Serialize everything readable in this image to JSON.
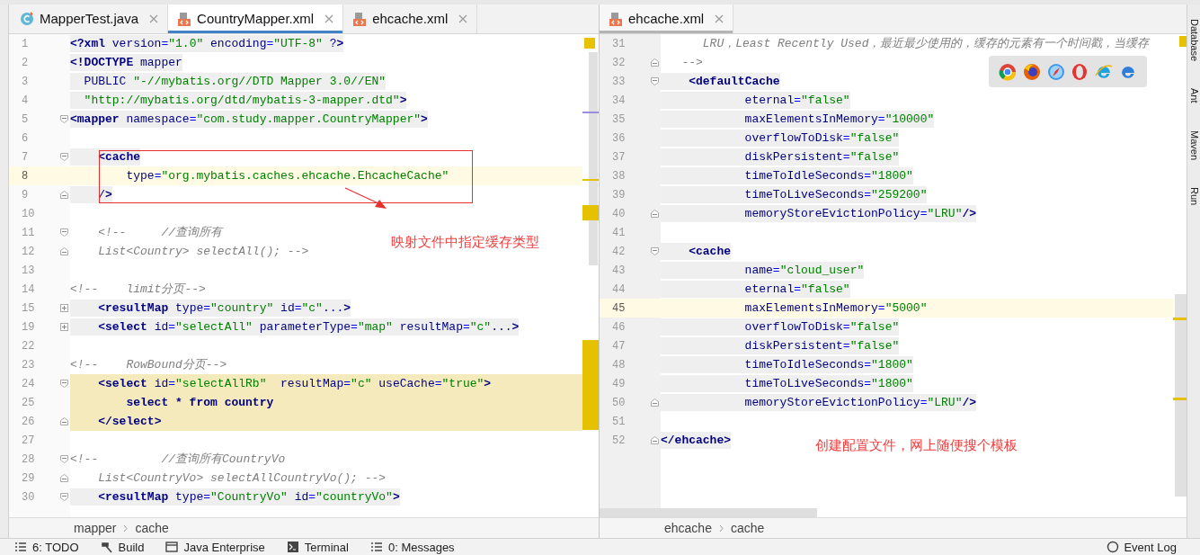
{
  "panes": [
    {
      "focused": true,
      "tabs": [
        {
          "label": "MapperTest.java",
          "kind": "class",
          "selected": false
        },
        {
          "label": "CountryMapper.xml",
          "kind": "xml",
          "selected": true
        },
        {
          "label": "ehcache.xml",
          "kind": "xml",
          "selected": false
        }
      ],
      "lines": [
        {
          "num": "1",
          "kind": "markup",
          "text": "<?xml version=\"1.0\" encoding=\"UTF-8\" ?>"
        },
        {
          "num": "2",
          "kind": "markup",
          "text": "<!DOCTYPE mapper"
        },
        {
          "num": "3",
          "kind": "markup",
          "text": "  PUBLIC \"-//mybatis.org//DTD Mapper 3.0//EN\""
        },
        {
          "num": "4",
          "kind": "markup",
          "text": "  \"http://mybatis.org/dtd/mybatis-3-mapper.dtd\">"
        },
        {
          "num": "5",
          "kind": "markup",
          "expanded": true,
          "text": "<mapper namespace=\"com.study.mapper.CountryMapper\">"
        },
        {
          "num": "6",
          "kind": "blank"
        },
        {
          "num": "7",
          "kind": "markup",
          "expanded": true,
          "text": "    <cache"
        },
        {
          "num": "8",
          "kind": "markup",
          "current": true,
          "text": "        type=\"org.mybatis.caches.ehcache.EhcacheCache\""
        },
        {
          "num": "9",
          "kind": "markup",
          "fold_end": true,
          "text": "    />"
        },
        {
          "num": "10",
          "kind": "blank"
        },
        {
          "num": "11",
          "kind": "comment",
          "expanded": true,
          "text": "    <!--     //查询所有"
        },
        {
          "num": "12",
          "kind": "comment",
          "fold_end": true,
          "text": "    List<Country> selectAll(); -->"
        },
        {
          "num": "13",
          "kind": "blank"
        },
        {
          "num": "14",
          "kind": "comment",
          "text": "<!--    limit分页-->"
        },
        {
          "num": "15",
          "kind": "markup",
          "expanded": false,
          "text": "    <resultMap type=\"country\" id=\"c\"...>"
        },
        {
          "num": "19",
          "kind": "markup",
          "expanded": false,
          "text": "    <select id=\"selectAll\" parameterType=\"map\" resultMap=\"c\"...>"
        },
        {
          "num": "22",
          "kind": "blank"
        },
        {
          "num": "23",
          "kind": "comment",
          "text": "<!--    RowBound分页-->"
        },
        {
          "num": "24",
          "kind": "markup",
          "expanded": true,
          "changed": true,
          "text": "    <select id=\"selectAllRb\"  resultMap=\"c\" useCache=\"true\">"
        },
        {
          "num": "25",
          "kind": "sql",
          "changed": true,
          "text": "        select * from country"
        },
        {
          "num": "26",
          "kind": "markup",
          "fold_end": true,
          "changed": true,
          "text": "    </select>"
        },
        {
          "num": "27",
          "kind": "blank"
        },
        {
          "num": "28",
          "kind": "comment",
          "expanded": true,
          "text": "<!--         //查询所有CountryVo"
        },
        {
          "num": "29",
          "kind": "comment",
          "fold_end": true,
          "text": "    List<CountryVo> selectAllCountryVo(); -->"
        },
        {
          "num": "30",
          "kind": "markup",
          "expanded": true,
          "text": "    <resultMap type=\"CountryVo\" id=\"countryVo\">"
        }
      ],
      "annotation": "映射文件中指定缓存类型",
      "breadcrumbs": [
        "mapper",
        "cache"
      ]
    },
    {
      "focused": false,
      "tabs": [
        {
          "label": "ehcache.xml",
          "kind": "xml",
          "selected": true
        }
      ],
      "lines": [
        {
          "num": "31",
          "kind": "comment",
          "text": "      LRU，Least Recently Used，最近最少使用的，缓存的元素有一个时间戳，当缓存"
        },
        {
          "num": "32",
          "kind": "comment",
          "fold_end": true,
          "text": "   -->"
        },
        {
          "num": "33",
          "kind": "markup",
          "expanded": true,
          "text": "    <defaultCache"
        },
        {
          "num": "34",
          "kind": "markup",
          "text": "            eternal=\"false\""
        },
        {
          "num": "35",
          "kind": "markup",
          "text": "            maxElementsInMemory=\"10000\""
        },
        {
          "num": "36",
          "kind": "markup",
          "text": "            overflowToDisk=\"false\""
        },
        {
          "num": "37",
          "kind": "markup",
          "text": "            diskPersistent=\"false\""
        },
        {
          "num": "38",
          "kind": "markup",
          "text": "            timeToIdleSeconds=\"1800\""
        },
        {
          "num": "39",
          "kind": "markup",
          "text": "            timeToLiveSeconds=\"259200\""
        },
        {
          "num": "40",
          "kind": "markup",
          "fold_end": true,
          "text": "            memoryStoreEvictionPolicy=\"LRU\"/>"
        },
        {
          "num": "41",
          "kind": "blank"
        },
        {
          "num": "42",
          "kind": "markup",
          "expanded": true,
          "text": "    <cache"
        },
        {
          "num": "43",
          "kind": "markup",
          "text": "            name=\"cloud_user\""
        },
        {
          "num": "44",
          "kind": "markup",
          "text": "            eternal=\"false\""
        },
        {
          "num": "45",
          "kind": "markup",
          "current": true,
          "text": "            maxElementsInMemory=\"5000\""
        },
        {
          "num": "46",
          "kind": "markup",
          "text": "            overflowToDisk=\"false\""
        },
        {
          "num": "47",
          "kind": "markup",
          "text": "            diskPersistent=\"false\""
        },
        {
          "num": "48",
          "kind": "markup",
          "text": "            timeToIdleSeconds=\"1800\""
        },
        {
          "num": "49",
          "kind": "markup",
          "text": "            timeToLiveSeconds=\"1800\""
        },
        {
          "num": "50",
          "kind": "markup",
          "fold_end": true,
          "text": "            memoryStoreEvictionPolicy=\"LRU\"/>"
        },
        {
          "num": "51",
          "kind": "blank"
        },
        {
          "num": "52",
          "kind": "markup",
          "fold_end": true,
          "text": "</ehcache>"
        }
      ],
      "annotation": "创建配置文件，网上随便搜个模板",
      "breadcrumbs": [
        "ehcache",
        "cache"
      ]
    }
  ],
  "right_tool_windows": [
    "Database",
    "Ant",
    "Maven",
    "Run"
  ],
  "bottom_tools": [
    {
      "label": "6: TODO",
      "kind": "list"
    },
    {
      "label": "Build",
      "kind": "hammer"
    },
    {
      "label": "Java Enterprise",
      "kind": "window"
    },
    {
      "label": "Terminal",
      "kind": "terminal"
    },
    {
      "label": "0: Messages",
      "kind": "list"
    }
  ],
  "event_log": "Event Log"
}
